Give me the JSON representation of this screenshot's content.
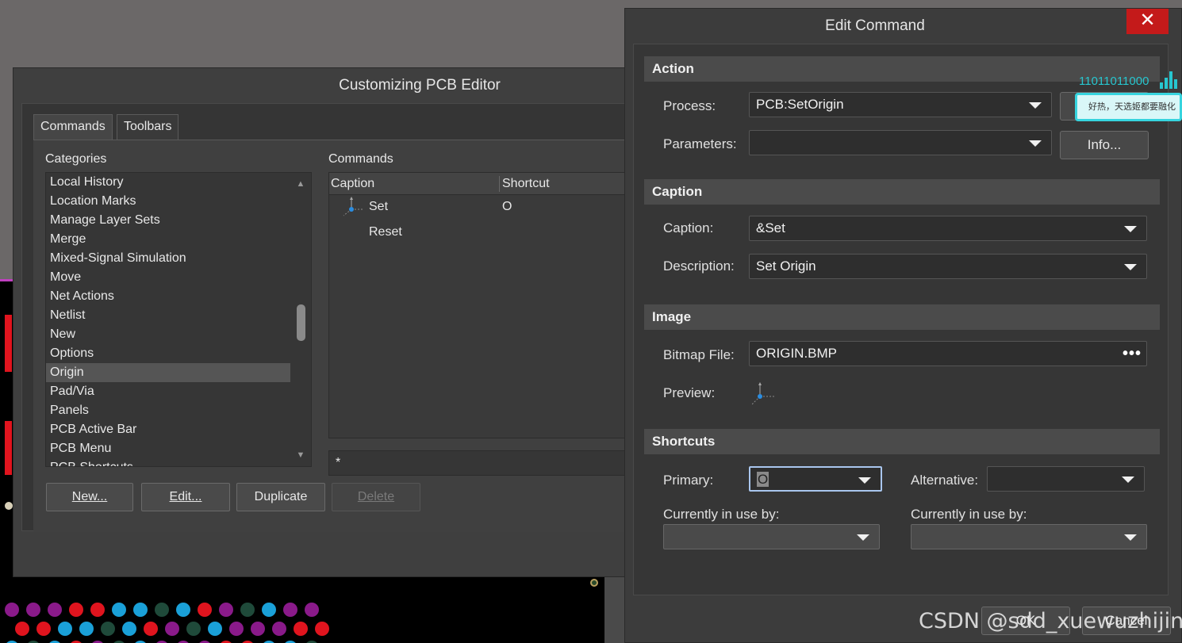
{
  "customize": {
    "title": "Customizing PCB Editor",
    "tabs": [
      "Commands",
      "Toolbars"
    ],
    "categories_label": "Categories",
    "commands_label": "Commands",
    "categories": [
      "Local History",
      "Location Marks",
      "Manage Layer Sets",
      "Merge",
      "Mixed-Signal Simulation",
      "Move",
      "Net Actions",
      "Netlist",
      "New",
      "Options",
      "Origin",
      "Pad/Via",
      "Panels",
      "PCB Active Bar",
      "PCB Menu",
      "PCB Shortcuts"
    ],
    "selected_category": "Origin",
    "columns": [
      "Caption",
      "Shortcut"
    ],
    "commands": [
      {
        "caption": "Set",
        "shortcut": "O"
      },
      {
        "caption": "Reset",
        "shortcut": ""
      }
    ],
    "filter_value": "*",
    "buttons": {
      "new": "New...",
      "edit": "Edit...",
      "duplicate": "Duplicate",
      "delete": "Delete"
    }
  },
  "edit": {
    "title": "Edit Command",
    "close": "✕",
    "action": {
      "header": "Action",
      "process_label": "Process:",
      "process_value": "PCB:SetOrigin",
      "parameters_label": "Parameters:",
      "parameters_value": "",
      "info_button": "Info..."
    },
    "caption": {
      "header": "Caption",
      "caption_label": "Caption:",
      "caption_value": "&Set",
      "description_label": "Description:",
      "description_value": "Set Origin"
    },
    "image": {
      "header": "Image",
      "bitmap_label": "Bitmap File:",
      "bitmap_value": "ORIGIN.BMP",
      "bitmap_browse": "•••",
      "preview_label": "Preview:"
    },
    "shortcuts": {
      "header": "Shortcuts",
      "primary_label": "Primary:",
      "primary_value": "O",
      "alternative_label": "Alternative:",
      "alternative_value": "",
      "in_use_label_1": "Currently in use by:",
      "in_use_label_2": "Currently in use by:"
    },
    "ok_button": "OK",
    "cancel_button": "Cancel"
  },
  "overlay": {
    "net_number": "11011011000",
    "net_text": "好热，天选姬都要融化了",
    "watermark": "CSDN @sdd_xuewuzhijing"
  },
  "colors": {
    "accent_red": "#c41a1a",
    "focus_border": "#a9c6ee",
    "pcb_red": "#e0141e",
    "pcb_cyan": "#1aa0d8",
    "pcb_magenta": "#8a1a8a"
  }
}
